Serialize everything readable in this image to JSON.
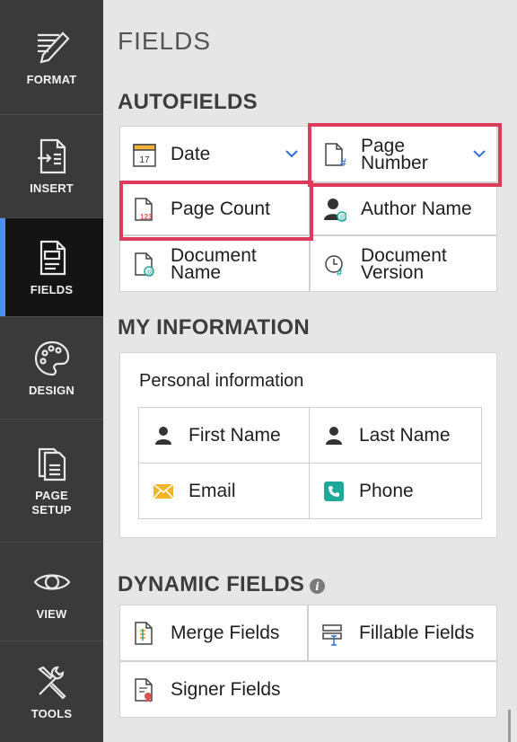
{
  "rail": {
    "items": [
      {
        "label": "FORMAT",
        "icon": "format-icon"
      },
      {
        "label": "INSERT",
        "icon": "insert-icon"
      },
      {
        "label": "FIELDS",
        "icon": "fields-icon",
        "active": true
      },
      {
        "label": "DESIGN",
        "icon": "palette-icon"
      },
      {
        "label": "PAGE\nSETUP",
        "icon": "page-setup-icon"
      },
      {
        "label": "VIEW",
        "icon": "eye-icon"
      },
      {
        "label": "TOOLS",
        "icon": "tools-icon"
      }
    ],
    "accent_color": "#4f8ef7"
  },
  "panel": {
    "title": "FIELDS",
    "autofields": {
      "title": "AUTOFIELDS",
      "buttons": [
        {
          "label": "Date",
          "icon": "calendar-icon",
          "icon_text": "17",
          "dropdown": true
        },
        {
          "label": "Page\nNumber",
          "icon": "page-number-icon",
          "dropdown": true,
          "highlighted": true
        },
        {
          "label": "Page Count",
          "icon": "page-count-icon",
          "icon_text": "123",
          "highlighted": true
        },
        {
          "label": "Author Name",
          "icon": "author-icon"
        },
        {
          "label": "Document\nName",
          "icon": "document-name-icon"
        },
        {
          "label": "Document\nVersion",
          "icon": "document-version-icon"
        }
      ]
    },
    "my_information": {
      "title": "MY INFORMATION",
      "card_title": "Personal information",
      "buttons": [
        {
          "label": "First Name",
          "icon": "person-icon"
        },
        {
          "label": "Last Name",
          "icon": "person-icon"
        },
        {
          "label": "Email",
          "icon": "email-icon"
        },
        {
          "label": "Phone",
          "icon": "phone-icon"
        }
      ]
    },
    "dynamic_fields": {
      "title": "DYNAMIC FIELDS",
      "info": "i",
      "buttons": [
        {
          "label": "Merge Fields",
          "icon": "merge-fields-icon"
        },
        {
          "label": "Fillable Fields",
          "icon": "fillable-fields-icon"
        },
        {
          "label": "Signer Fields",
          "icon": "signer-fields-icon"
        }
      ]
    }
  },
  "colors": {
    "highlight": "#dd3a5c",
    "rail_bg": "#3a3a3a",
    "rail_active_bg": "#141414",
    "panel_bg": "#e6e6e6",
    "chevron": "#2f6fd6",
    "email_icon": "#f5b32a",
    "phone_icon": "#21a89a"
  }
}
